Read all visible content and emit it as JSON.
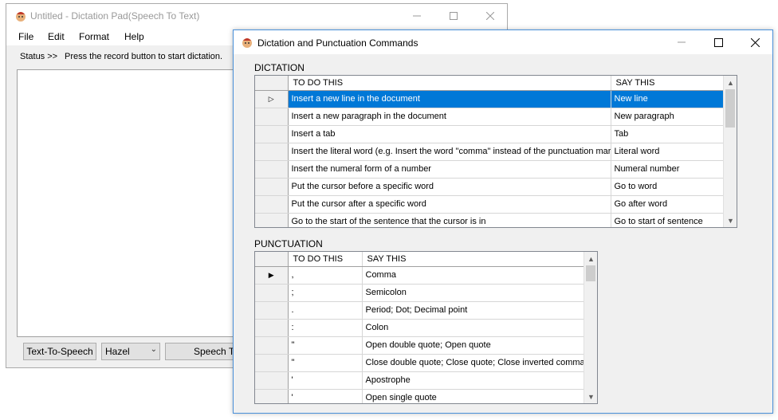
{
  "main_window": {
    "title": "Untitled - Dictation Pad(Speech To Text)",
    "menu": [
      "File",
      "Edit",
      "Format",
      "Help"
    ],
    "status_label": "Status >>",
    "status_text": "Press the record button to start dictation.",
    "tts_button": "Text-To-Speech",
    "voice": "Hazel",
    "speech_button": "Speech To Text"
  },
  "dialog": {
    "title": "Dictation and Punctuation Commands",
    "dictation_label": "DICTATION",
    "punctuation_label": "PUNCTUATION",
    "dictation_columns": [
      "TO DO THIS",
      "SAY THIS"
    ],
    "dictation_rows": [
      [
        "Insert a new line in the document",
        "New line"
      ],
      [
        "Insert a new paragraph in the document",
        "New paragraph"
      ],
      [
        "Insert a tab",
        "Tab"
      ],
      [
        "Insert the literal word (e.g. Insert the word \"comma\" instead of the punctuation mark)",
        "Literal word"
      ],
      [
        "Insert the numeral form of a number",
        "Numeral number"
      ],
      [
        "Put the cursor before a specific word",
        "Go to word"
      ],
      [
        "Put the cursor after a specific word",
        "Go after word"
      ],
      [
        "Go to the start of the sentence that the cursor is in",
        "Go to start of sentence"
      ]
    ],
    "punctuation_columns": [
      "TO DO THIS",
      "SAY THIS"
    ],
    "punctuation_rows": [
      [
        ",",
        "Comma"
      ],
      [
        ";",
        "Semicolon"
      ],
      [
        ".",
        "Period; Dot; Decimal point"
      ],
      [
        ":",
        "Colon"
      ],
      [
        "\"",
        "Open double quote; Open quote"
      ],
      [
        "\"",
        "Close double quote; Close quote; Close inverted commas"
      ],
      [
        "'",
        "Apostrophe"
      ],
      [
        "'",
        "Open single quote"
      ]
    ]
  },
  "colors": {
    "selection": "#0078d7",
    "dialog_border": "#4a90d9"
  },
  "icons": [
    "app-icon",
    "minimize-icon",
    "maximize-icon",
    "close-icon",
    "row-indicator-icon",
    "scroll-up-icon",
    "scroll-down-icon",
    "dropdown-icon"
  ]
}
